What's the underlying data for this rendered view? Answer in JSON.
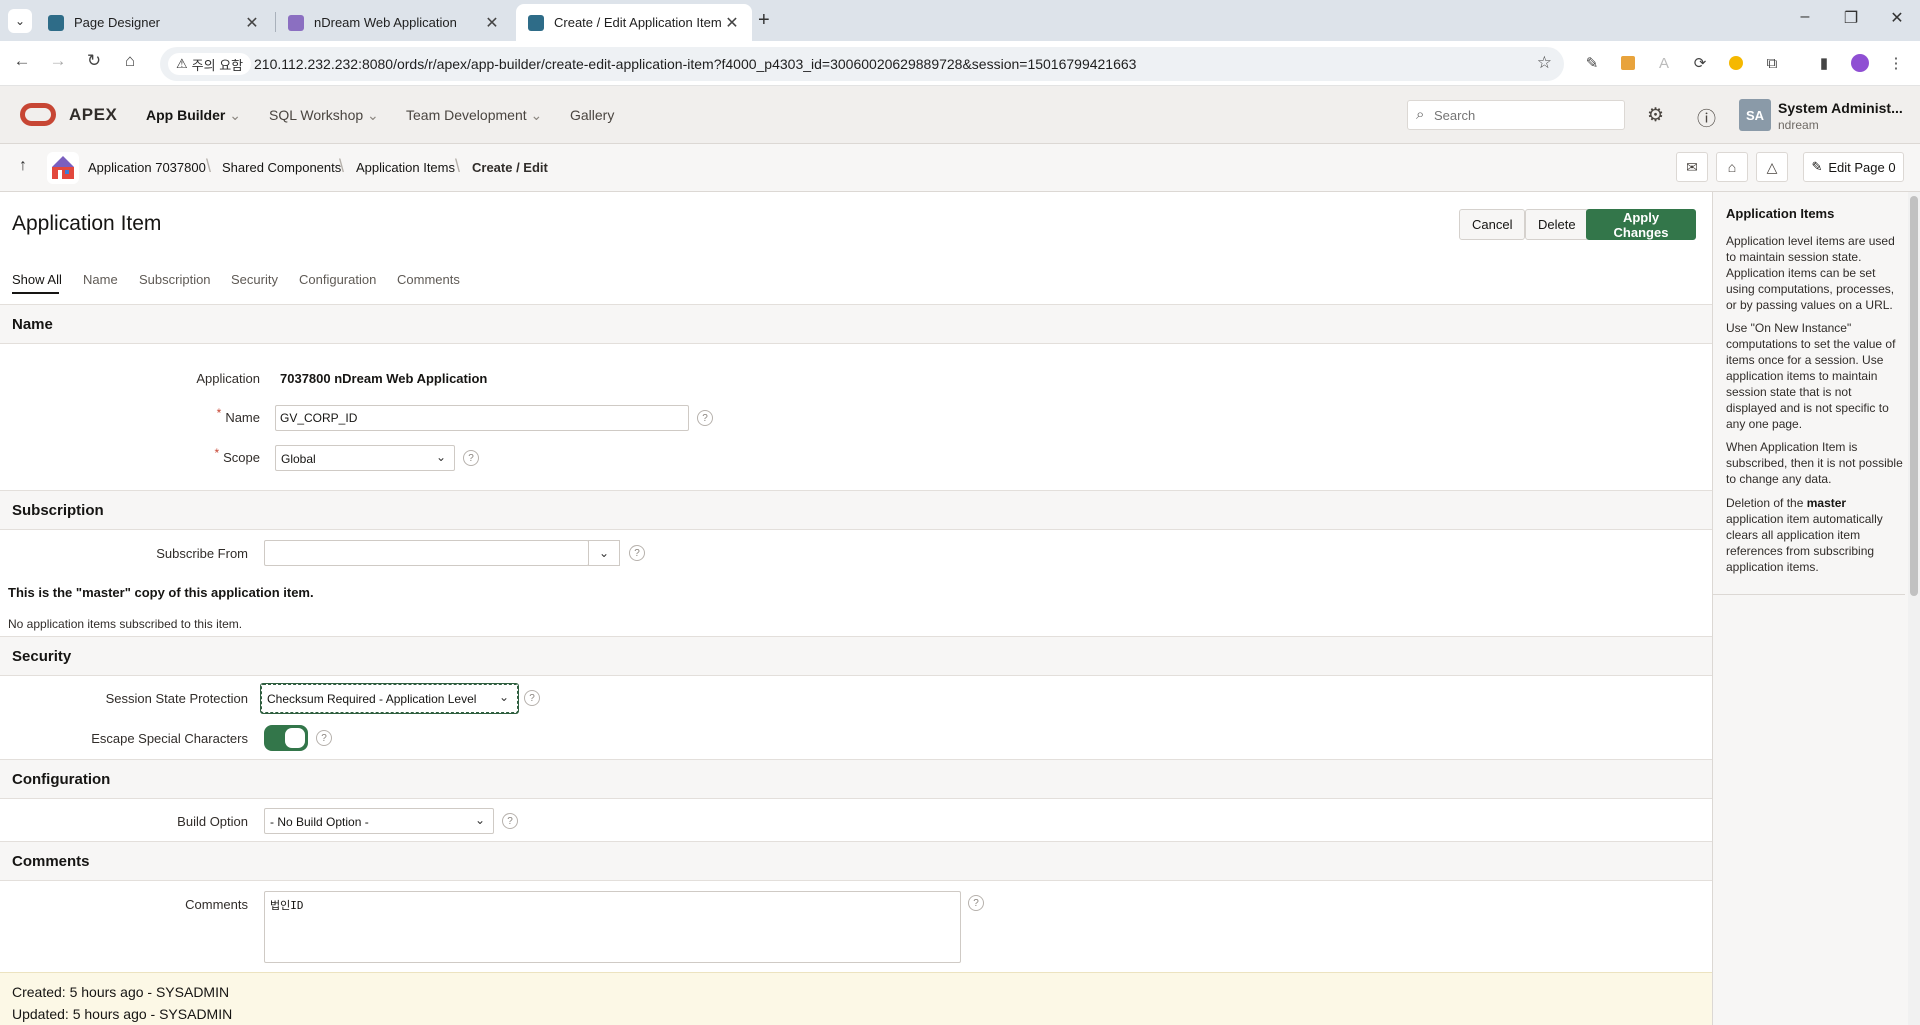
{
  "browser": {
    "tabs": [
      {
        "title": "Page Designer",
        "active": false
      },
      {
        "title": "nDream Web Application",
        "active": false
      },
      {
        "title": "Create / Edit Application Item",
        "active": true
      }
    ],
    "security_warning": "주의 요함",
    "url": "210.112.232.232:8080/ords/r/apex/app-builder/create-edit-application-item?f4000_p4303_id=30060020629889728&session=15016799421663"
  },
  "header": {
    "logo": "APEX",
    "menus": [
      "App Builder",
      "SQL Workshop",
      "Team Development",
      "Gallery"
    ],
    "search_placeholder": "Search",
    "user": {
      "initials": "SA",
      "name": "System Administ...",
      "workspace": "ndream"
    }
  },
  "breadcrumb": {
    "items": [
      "Application 7037800",
      "Shared Components",
      "Application Items",
      "Create / Edit"
    ],
    "edit_page_label": "Edit Page 0"
  },
  "page": {
    "title": "Application Item",
    "buttons": {
      "cancel": "Cancel",
      "delete": "Delete",
      "apply": "Apply Changes"
    },
    "tabs": [
      "Show All",
      "Name",
      "Subscription",
      "Security",
      "Configuration",
      "Comments"
    ]
  },
  "name_region": {
    "title": "Name",
    "application_label": "Application",
    "application_value": "7037800 nDream Web Application",
    "name_label": "Name",
    "name_value": "GV_CORP_ID",
    "scope_label": "Scope",
    "scope_value": "Global"
  },
  "subscription_region": {
    "title": "Subscription",
    "subscribe_from_label": "Subscribe From",
    "subscribe_from_value": "",
    "master_note": "This is the \"master\" copy of this application item.",
    "subscribed_note": "No application items subscribed to this item."
  },
  "security_region": {
    "title": "Security",
    "ssp_label": "Session State Protection",
    "ssp_value": "Checksum Required - Application Level",
    "escape_label": "Escape Special Characters",
    "escape_on": true
  },
  "configuration_region": {
    "title": "Configuration",
    "build_option_label": "Build Option",
    "build_option_value": "- No Build Option -"
  },
  "comments_region": {
    "title": "Comments",
    "comments_label": "Comments",
    "comments_value": "법인ID"
  },
  "audit": {
    "created": "Created: 5 hours ago - SYSADMIN",
    "updated": "Updated: 5 hours ago - SYSADMIN"
  },
  "help_panel": {
    "title": "Application Items",
    "p1": "Application level items are used to maintain session state. Application items can be set using computations, processes, or by passing values on a URL.",
    "p2": "Use \"On New Instance\" computations to set the value of items once for a session. Use application items to maintain session state that is not displayed and is not specific to any one page.",
    "p3": "When Application Item is subscribed, then it is not possible to change any data.",
    "p4_pre": "Deletion of the ",
    "p4_bold": "master",
    "p4_post": " application item automatically clears all application item references from subscribing application items."
  },
  "colors": {
    "accent": "#33764a",
    "brand": "#c74634",
    "header_bg": "#f1efed"
  }
}
